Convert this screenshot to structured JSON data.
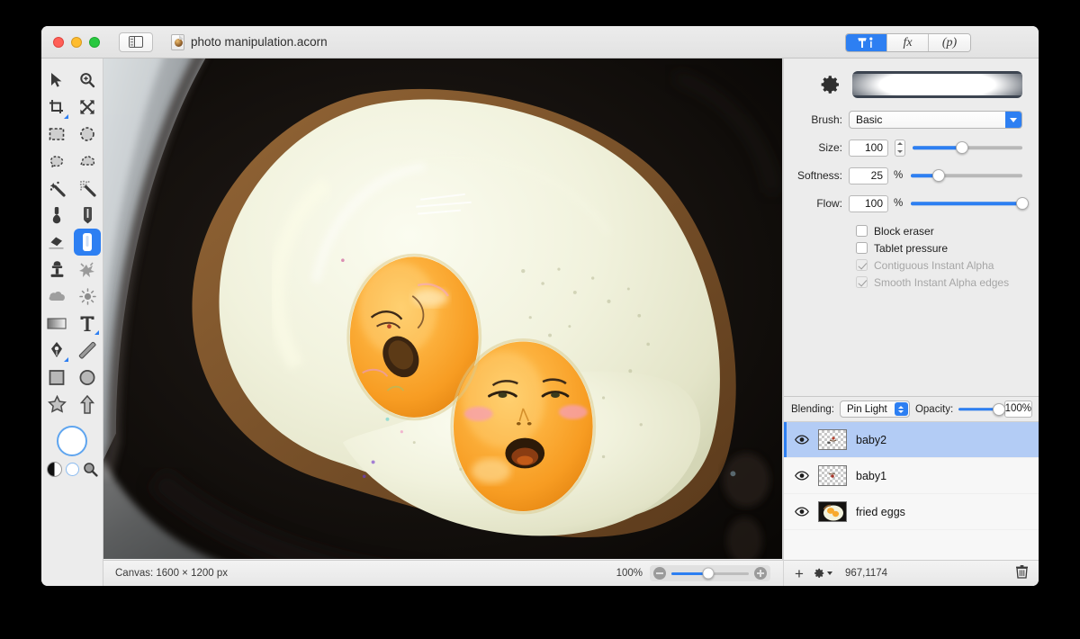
{
  "window": {
    "title": "photo manipulation.acorn",
    "traffic_lights": [
      "close",
      "minimize",
      "zoom"
    ],
    "sidebar_toggle_icon": "sidebar-toggle-icon",
    "document_icon": "acorn-document-icon"
  },
  "inspector_tabs": [
    {
      "id": "tools",
      "label": "",
      "icon": "hammer-tools-icon",
      "active": true
    },
    {
      "id": "filters",
      "label": "fx",
      "icon": "fx-icon",
      "active": false
    },
    {
      "id": "palette",
      "label": "(p)",
      "icon": "palette-icon",
      "active": false
    }
  ],
  "tools": [
    {
      "name": "move-tool",
      "icon": "arrow-cursor-icon",
      "selected": false,
      "submenu": false
    },
    {
      "name": "zoom-tool",
      "icon": "magnifier-plus-icon",
      "selected": false,
      "submenu": false
    },
    {
      "name": "crop-tool",
      "icon": "crop-icon",
      "selected": false,
      "submenu": true
    },
    {
      "name": "transform-tool",
      "icon": "move-arrows-icon",
      "selected": false,
      "submenu": false
    },
    {
      "name": "rect-select-tool",
      "icon": "rect-marquee-icon",
      "selected": false,
      "submenu": false
    },
    {
      "name": "ellipse-select-tool",
      "icon": "ellipse-marquee-icon",
      "selected": false,
      "submenu": false
    },
    {
      "name": "lasso-tool",
      "icon": "lasso-icon",
      "selected": false,
      "submenu": false
    },
    {
      "name": "polygon-select-tool",
      "icon": "polygon-lasso-icon",
      "selected": false,
      "submenu": false
    },
    {
      "name": "magic-wand-tool",
      "icon": "magic-wand-icon",
      "selected": false,
      "submenu": false
    },
    {
      "name": "instant-alpha-tool",
      "icon": "instant-alpha-icon",
      "selected": false,
      "submenu": false
    },
    {
      "name": "paint-bucket-tool",
      "icon": "paint-dauber-icon",
      "selected": false,
      "submenu": false
    },
    {
      "name": "pencil-tool",
      "icon": "pencil-icon",
      "selected": false,
      "submenu": false
    },
    {
      "name": "eraser-tool",
      "icon": "eraser-icon",
      "selected": false,
      "submenu": false
    },
    {
      "name": "brush-tool",
      "icon": "paint-brush-icon",
      "selected": true,
      "submenu": false
    },
    {
      "name": "clone-stamp-tool",
      "icon": "clone-stamp-icon",
      "selected": false,
      "submenu": false
    },
    {
      "name": "smudge-tool",
      "icon": "smudge-splatter-icon",
      "selected": false,
      "submenu": false
    },
    {
      "name": "blur-tool",
      "icon": "cloud-blur-icon",
      "selected": false,
      "submenu": false
    },
    {
      "name": "dodge-burn-tool",
      "icon": "sun-dodge-icon",
      "selected": false,
      "submenu": false
    },
    {
      "name": "gradient-tool",
      "icon": "gradient-icon",
      "selected": false,
      "submenu": false
    },
    {
      "name": "text-tool",
      "icon": "text-t-icon",
      "selected": false,
      "submenu": true
    },
    {
      "name": "bezier-pen-tool",
      "icon": "pen-nib-icon",
      "selected": false,
      "submenu": true
    },
    {
      "name": "line-tool",
      "icon": "line-icon",
      "selected": false,
      "submenu": false
    },
    {
      "name": "rectangle-shape-tool",
      "icon": "square-shape-icon",
      "selected": false,
      "submenu": false
    },
    {
      "name": "ellipse-shape-tool",
      "icon": "circle-shape-icon",
      "selected": false,
      "submenu": false
    },
    {
      "name": "star-shape-tool",
      "icon": "star-shape-icon",
      "selected": false,
      "submenu": false
    },
    {
      "name": "arrow-shape-tool",
      "icon": "arrow-shape-icon",
      "selected": false,
      "submenu": false
    }
  ],
  "color_controls": {
    "foreground_color": "#ffffff",
    "foreground_name": "foreground-color-swatch",
    "swap_name": "black-white-swatch",
    "background_name": "background-color-swatch",
    "picker_name": "color-picker-magnifier-icon"
  },
  "brush_panel": {
    "gear_icon": "gear-icon",
    "preview_name": "brush-preview",
    "brush": {
      "label": "Brush:",
      "value": "Basic"
    },
    "size": {
      "label": "Size:",
      "value": "100",
      "slider_pct": 45
    },
    "softness": {
      "label": "Softness:",
      "value": "25",
      "unit": "%",
      "slider_pct": 25
    },
    "flow": {
      "label": "Flow:",
      "value": "100",
      "unit": "%",
      "slider_pct": 100
    },
    "checkboxes": [
      {
        "label": "Block eraser",
        "checked": false,
        "disabled": false
      },
      {
        "label": "Tablet pressure",
        "checked": false,
        "disabled": false
      },
      {
        "label": "Contiguous Instant Alpha",
        "checked": true,
        "disabled": true
      },
      {
        "label": "Smooth Instant Alpha edges",
        "checked": true,
        "disabled": true
      }
    ]
  },
  "layers_panel": {
    "blending_label": "Blending:",
    "blending_value": "Pin Light",
    "opacity_label": "Opacity:",
    "opacity_value": "100%",
    "opacity_pct": 100,
    "rows": [
      {
        "name": "baby2",
        "visible": true,
        "selected": true,
        "thumb": "transparent"
      },
      {
        "name": "baby1",
        "visible": true,
        "selected": false,
        "thumb": "transparent"
      },
      {
        "name": "fried eggs",
        "visible": true,
        "selected": false,
        "thumb": "photo"
      }
    ],
    "footer": {
      "add_label": "+",
      "settings_icon": "gear-dropdown-icon",
      "coordinates": "967,1174",
      "trash_icon": "trash-icon"
    }
  },
  "status_bar": {
    "canvas_label": "Canvas: 1600 × 1200 px",
    "zoom_value": "100%",
    "zoom_pct": 48,
    "zoom_out_icon": "zoom-out-icon",
    "zoom_in_icon": "zoom-in-icon"
  },
  "canvas": {
    "description": "Photo of two fried eggs in a dark non-stick frying pan with baby faces composited onto the yolks",
    "colors": {
      "pan": "#151210",
      "white": "#f2f3e2",
      "yolk": "#f9aa2e",
      "browned_edge": "#8a6035",
      "pan_rim": "#c9cdd0"
    }
  }
}
